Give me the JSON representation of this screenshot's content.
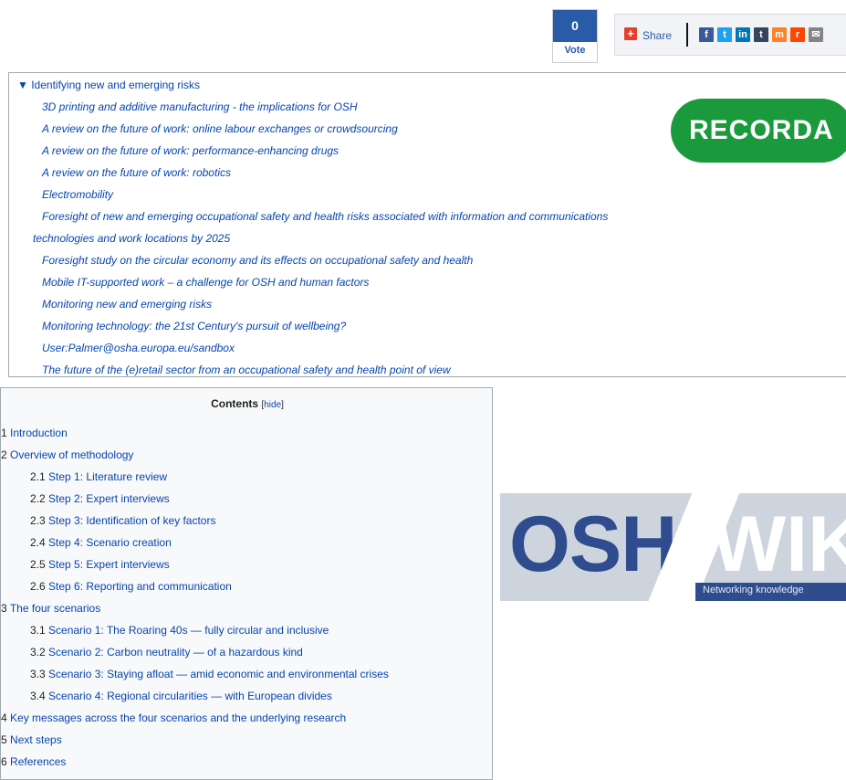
{
  "vote": {
    "count": "0",
    "label": "Vote"
  },
  "share": {
    "label": "Share",
    "icons": [
      {
        "name": "facebook-icon",
        "glyph": "f",
        "color": "#3b5998"
      },
      {
        "name": "twitter-icon",
        "glyph": "t",
        "color": "#1da1f2"
      },
      {
        "name": "linkedin-icon",
        "glyph": "in",
        "color": "#0077b5"
      },
      {
        "name": "tumblr-icon",
        "glyph": "t",
        "color": "#35465c"
      },
      {
        "name": "mix-icon",
        "glyph": "m",
        "color": "#ff8226"
      },
      {
        "name": "reddit-icon",
        "glyph": "r",
        "color": "#ff4500"
      },
      {
        "name": "email-icon",
        "glyph": "✉",
        "color": "#848484"
      }
    ]
  },
  "related": {
    "heading": "▼ Identifying new and emerging risks",
    "items": [
      "3D printing and additive manufacturing - the implications for OSH",
      "A review on the future of work: online labour exchanges or crowdsourcing",
      "A review on the future of work: performance-enhancing drugs",
      "A review on the future of work: robotics",
      "Electromobility",
      "Foresight of new and emerging occupational safety and health risks associated with information and communications",
      "technologies and work locations by 2025",
      "Foresight study on the circular economy and its effects on occupational safety and health",
      "Mobile IT-supported work – a challenge for OSH and human factors",
      "Monitoring new and emerging risks",
      "Monitoring technology: the 21st Century's pursuit of wellbeing?",
      "User:Palmer@osha.europa.eu/sandbox",
      "The future of the (e)retail sector from an occupational safety and health point of view"
    ],
    "logo_text": "RECORDA"
  },
  "toc": {
    "title": "Contents",
    "hide_open": "[",
    "hide_label": "hide",
    "hide_close": "]",
    "items": [
      {
        "num": "1",
        "label": "Introduction"
      },
      {
        "num": "2",
        "label": "Overview of methodology"
      },
      {
        "num": "2.1",
        "label": "Step 1: Literature review"
      },
      {
        "num": "2.2",
        "label": "Step 2: Expert interviews"
      },
      {
        "num": "2.3",
        "label": "Step 3: Identification of key factors"
      },
      {
        "num": "2.4",
        "label": "Step 4: Scenario creation"
      },
      {
        "num": "2.5",
        "label": "Step 5: Expert interviews"
      },
      {
        "num": "2.6",
        "label": "Step 6: Reporting and communication"
      },
      {
        "num": "3",
        "label": "The four scenarios"
      },
      {
        "num": "3.1",
        "label": "Scenario 1: The Roaring 40s — fully circular and inclusive"
      },
      {
        "num": "3.2",
        "label": "Scenario 2: Carbon neutrality — of a hazardous kind"
      },
      {
        "num": "3.3",
        "label": "Scenario 3: Staying afloat — amid economic and environmental crises"
      },
      {
        "num": "3.4",
        "label": "Scenario 4: Regional circularities — with European divides"
      },
      {
        "num": "4",
        "label": "Key messages across the four scenarios and the underlying research"
      },
      {
        "num": "5",
        "label": "Next steps"
      },
      {
        "num": "6",
        "label": "References"
      }
    ]
  },
  "osh_logo": {
    "left": "OSH",
    "right": "WIKI",
    "tagline": "Networking knowledge"
  }
}
